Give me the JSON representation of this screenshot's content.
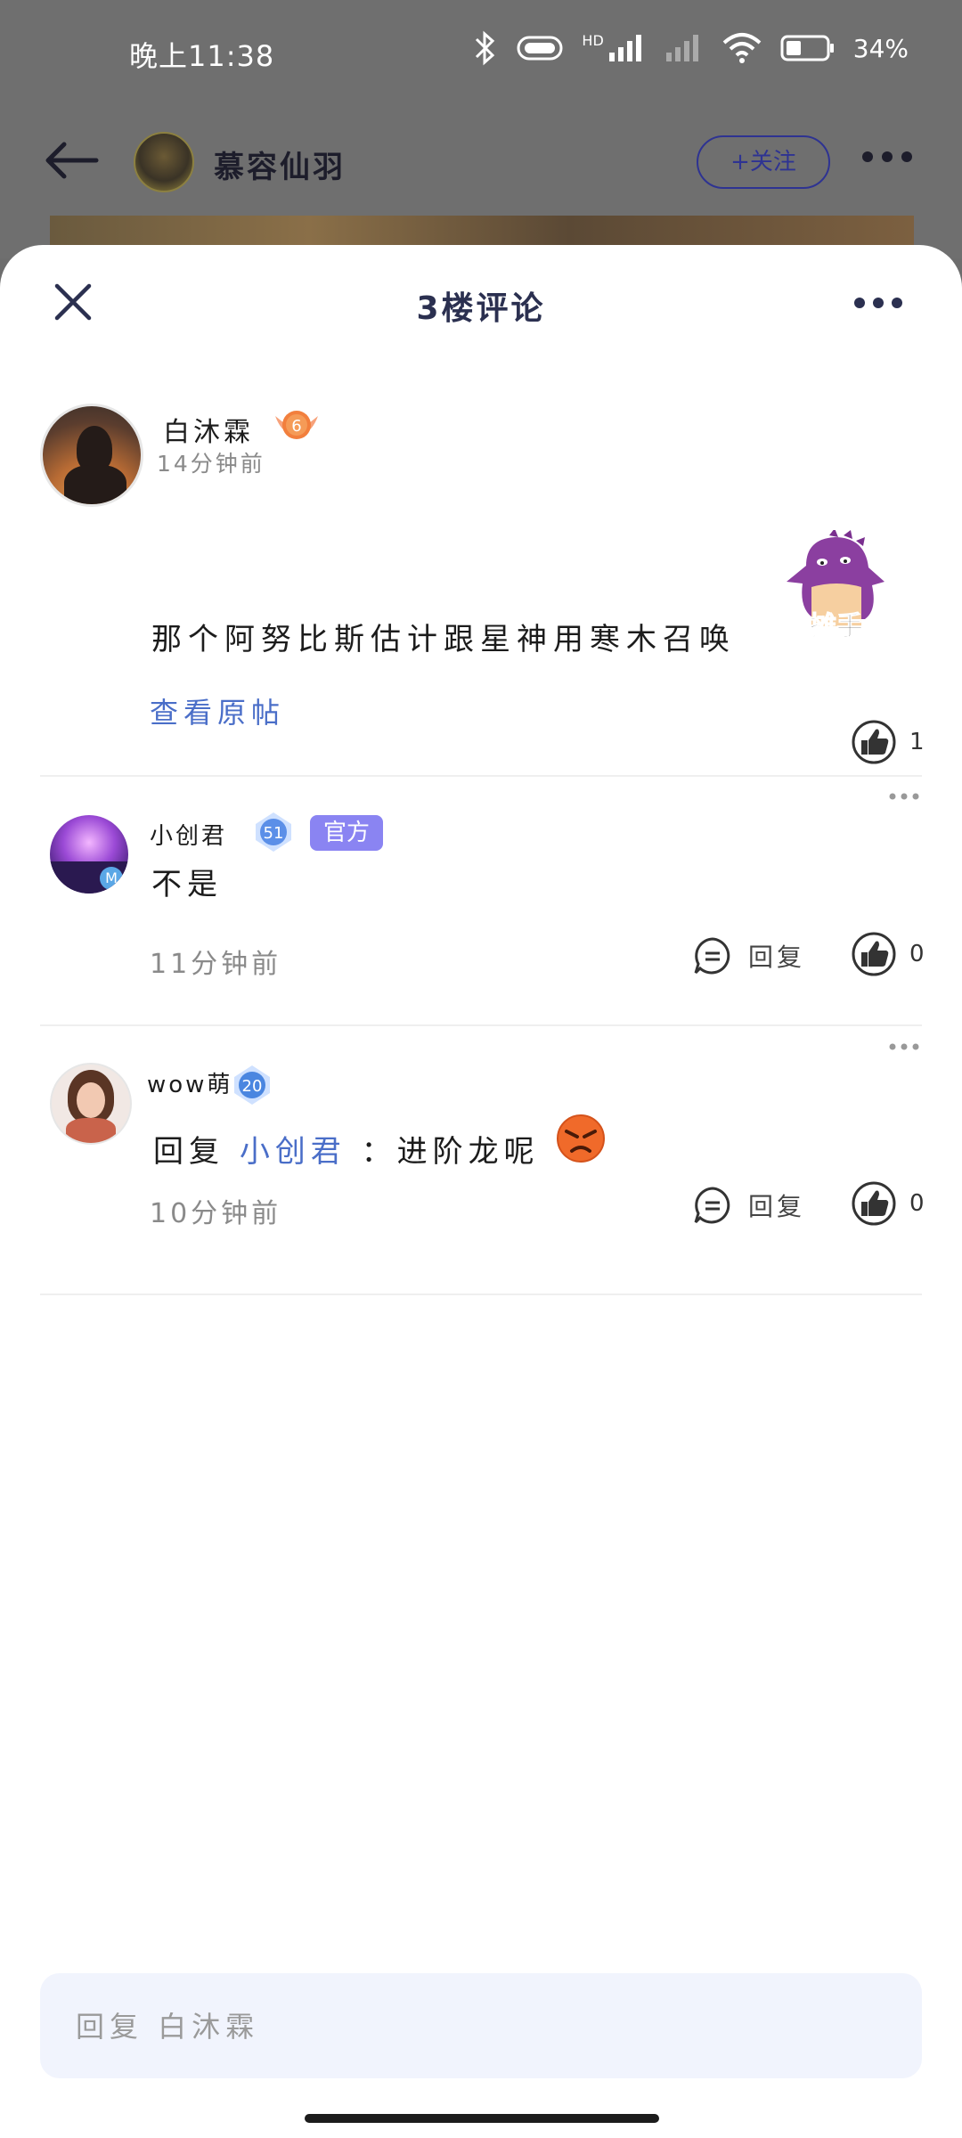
{
  "status_bar": {
    "time": "晚上11:38",
    "battery": "34%",
    "network_tag": "HD"
  },
  "background_post": {
    "author": "慕容仙羽",
    "follow_label": "+关注"
  },
  "sheet": {
    "title": "3楼评论"
  },
  "main_comment": {
    "author": "白沐霖",
    "level": "6",
    "time": "14分钟前",
    "sticker_text": "摊手",
    "text": "那个阿努比斯估计跟星神用寒木召唤",
    "view_original": "查看原帖",
    "likes": "1"
  },
  "replies": [
    {
      "author": "小创君",
      "level": "51",
      "badge": "官方",
      "avatar_tag": "M",
      "text": "不是",
      "time": "11分钟前",
      "reply_label": "回复",
      "likes": "0"
    },
    {
      "author": "wow萌",
      "level": "20",
      "text_prefix": "回复",
      "mention": "小创君",
      "text_suffix": "：进阶龙呢",
      "time": "10分钟前",
      "reply_label": "回复",
      "likes": "0"
    }
  ],
  "input": {
    "placeholder": "回复 白沐霖"
  },
  "colors": {
    "accent_blue": "#4a6ec8",
    "official_badge": "#8a84f2",
    "input_bg": "#f1f4fd",
    "title": "#2b3050"
  },
  "icons": [
    "back-arrow-icon",
    "more-dots-icon",
    "close-icon",
    "like-icon",
    "comment-icon",
    "level-badge-icon",
    "angry-emoji-icon",
    "bluetooth-icon",
    "wifi-icon",
    "signal-icon",
    "battery-icon"
  ]
}
